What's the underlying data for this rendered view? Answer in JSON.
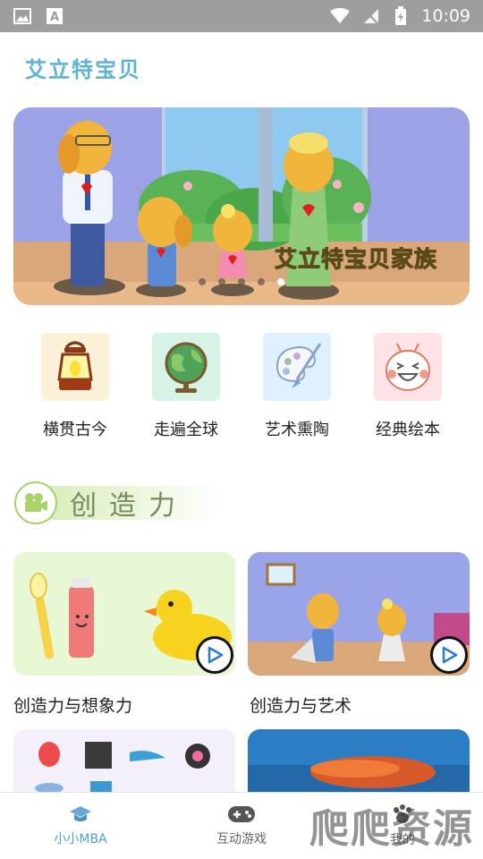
{
  "status_bar": {
    "time": "10:09"
  },
  "app": {
    "title": "艾立特宝贝"
  },
  "banner": {
    "caption": "艾立特宝贝家族",
    "slide_count": 5,
    "active_slide": 5
  },
  "categories": [
    {
      "label": "横贯古今",
      "icon": "lantern-icon",
      "bg": "#fbf1d8"
    },
    {
      "label": "走遍全球",
      "icon": "globe-icon",
      "bg": "#d6f3e6"
    },
    {
      "label": "艺术熏陶",
      "icon": "palette-icon",
      "bg": "#dff0ff"
    },
    {
      "label": "经典绘本",
      "icon": "smiley-face-icon",
      "bg": "#ffe3e6"
    }
  ],
  "section": {
    "title": "创造力"
  },
  "cards": [
    {
      "title": "创造力与想象力"
    },
    {
      "title": "创造力与艺术"
    }
  ],
  "bottom_nav": [
    {
      "label": "小小MBA",
      "icon": "graduation-cap-icon",
      "active": true
    },
    {
      "label": "互动游戏",
      "icon": "gamepad-icon",
      "active": false
    },
    {
      "label": "我的",
      "icon": "paw-icon",
      "active": false
    }
  ],
  "watermark": {
    "text": "爬爬资源"
  },
  "colors": {
    "accent": "#4d9fd0",
    "status_bar": "#9e9e9e",
    "section_accent": "#a9d36a"
  }
}
